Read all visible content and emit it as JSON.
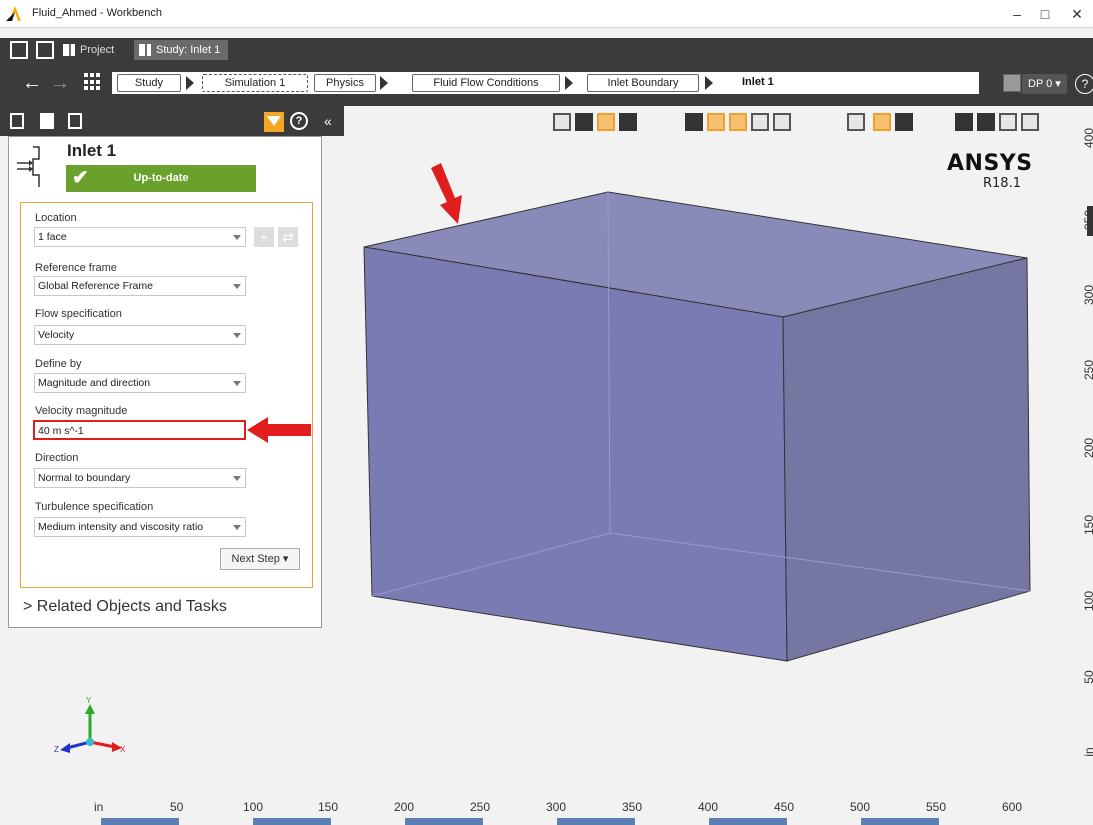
{
  "window": {
    "title": "Fluid_Ahmed - Workbench",
    "minimize": "–",
    "maximize": "□",
    "close": "✕"
  },
  "tabs": [
    {
      "label": "Project"
    },
    {
      "label": "Study: Inlet 1"
    }
  ],
  "breadcrumb": {
    "back": "←",
    "forward": "→",
    "items": [
      "Study",
      "Simulation 1",
      "Physics",
      "Fluid Flow Conditions",
      "Inlet Boundary"
    ],
    "current": "Inlet 1",
    "dp": "DP 0 ▾",
    "help": "?"
  },
  "panel_toolbar": {
    "help": "?",
    "collapse": "«"
  },
  "panel": {
    "title": "Inlet 1",
    "status": "Up-to-date",
    "fields": [
      {
        "label": "Location",
        "value": "1 face"
      },
      {
        "label": "Reference frame",
        "value": "Global Reference Frame"
      },
      {
        "label": "Flow specification",
        "value": "Velocity"
      },
      {
        "label": "Define by",
        "value": "Magnitude and direction"
      },
      {
        "label": "Velocity magnitude",
        "value": "40 m s^-1"
      },
      {
        "label": "Direction",
        "value": "Normal to boundary"
      },
      {
        "label": "Turbulence specification",
        "value": "Medium intensity and viscosity ratio"
      }
    ],
    "add": "+",
    "swap": "⇄",
    "next_step": "Next Step ▾",
    "related": "> Related Objects and Tasks"
  },
  "viewport": {
    "logo": "ANSYS",
    "version": "R18.1",
    "right_ruler": [
      "400",
      "350",
      "300",
      "250",
      "200",
      "150",
      "100",
      "50",
      "in"
    ],
    "bottom_ruler": [
      "in",
      "50",
      "100",
      "150",
      "200",
      "250",
      "300",
      "350",
      "400",
      "450",
      "500",
      "550",
      "600"
    ],
    "axes": {
      "x": "X",
      "y": "Y",
      "z": "Z"
    }
  },
  "colors": {
    "accent_orange": "#f5a623",
    "status_green": "#6aa12c",
    "highlight_red": "#e01e1e",
    "geometry_fill": "#7f7fb5"
  }
}
